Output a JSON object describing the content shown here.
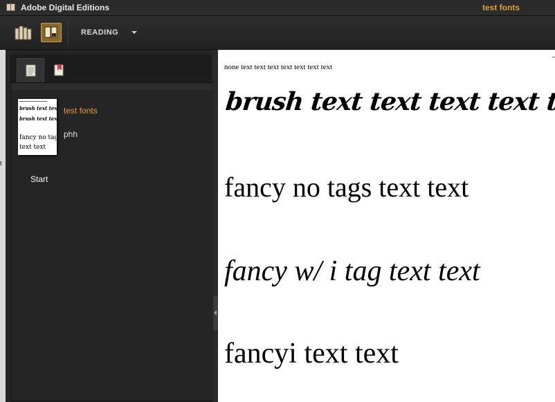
{
  "window": {
    "app_title": "Adobe Digital Editions",
    "document_title": "test fonts"
  },
  "toolbar": {
    "library_icon": "library-icon",
    "reading_icon": "reading-view-icon",
    "view_label": "READING",
    "dropdown_icon": "chevron-down-icon"
  },
  "sidebar": {
    "tabs": [
      {
        "name": "contents",
        "icon": "table-of-contents-icon",
        "selected": true
      },
      {
        "name": "bookmarks",
        "icon": "bookmark-icon",
        "selected": false
      }
    ],
    "book": {
      "title": "test fonts",
      "author": "phh",
      "thumbnail_lines": [
        "brush text text",
        "brush text text",
        "fancy no tags",
        "text text"
      ]
    },
    "toc": [
      {
        "label": "Start"
      }
    ]
  },
  "content": {
    "lines": [
      "none text text text text text text text",
      "brush text text text text text",
      "fancy no tags text text",
      "fancy w/ i tag text text",
      "fancyi text text"
    ]
  },
  "left_edge_mark": "t",
  "colors": {
    "accent": "#e0a030",
    "background": "#1e1e1e",
    "page": "#ffffff"
  }
}
